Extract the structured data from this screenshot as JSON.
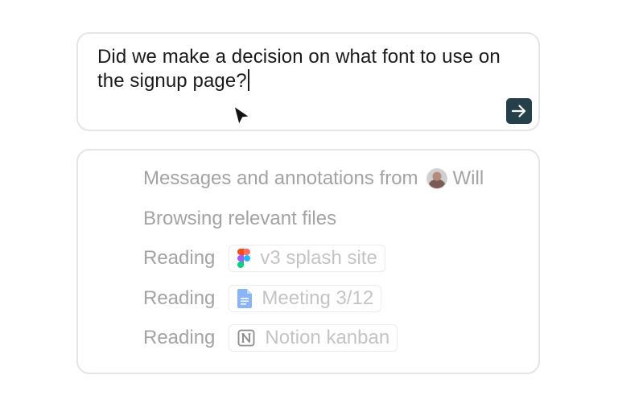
{
  "query": {
    "text": "Did we make a decision on what font to use on the signup page?",
    "send_icon": "arrow-right-icon"
  },
  "activity": {
    "messages_label": "Messages and annotations from",
    "user_name": "Will",
    "browsing_label": "Browsing relevant files",
    "reading_items": [
      {
        "label": "Reading",
        "source": "Figma",
        "icon": "figma-icon",
        "title": "v3 splash site"
      },
      {
        "label": "Reading",
        "source": "Google Docs",
        "icon": "google-docs-icon",
        "title": "Meeting 3/12"
      },
      {
        "label": "Reading",
        "source": "Notion",
        "icon": "notion-icon",
        "title": "Notion kanban"
      }
    ]
  },
  "colors": {
    "send_button": "#25404a",
    "text_primary": "#1a1a1a",
    "text_muted": "#a3a3a3",
    "chip_text": "#c4c4c4",
    "border": "#e5e5e5"
  }
}
